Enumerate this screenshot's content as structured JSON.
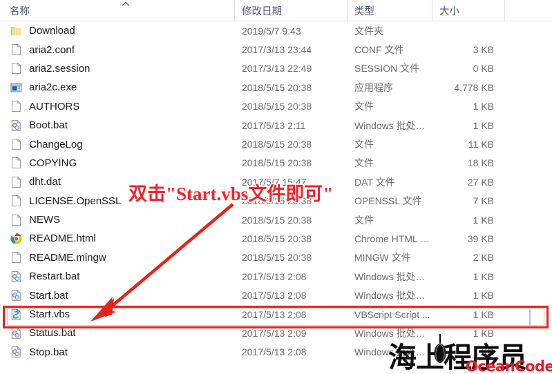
{
  "window": {
    "app": "windows-file-explorer-details-view"
  },
  "columns": {
    "name": "名称",
    "date_modified": "修改日期",
    "type": "类型",
    "size": "大小",
    "sort_indicator": "chevron-up-icon"
  },
  "files": [
    {
      "name": "Download",
      "icon": "folder-icon",
      "date": "2019/5/7 9:43",
      "type": "文件夹",
      "size": ""
    },
    {
      "name": "aria2.conf",
      "icon": "generic-file-icon",
      "date": "2017/3/13 23:44",
      "type": "CONF 文件",
      "size": "3 KB"
    },
    {
      "name": "aria2.session",
      "icon": "generic-file-icon",
      "date": "2017/3/13 22:49",
      "type": "SESSION 文件",
      "size": "0 KB"
    },
    {
      "name": "aria2c.exe",
      "icon": "executable-icon",
      "date": "2018/5/15 20:38",
      "type": "应用程序",
      "size": "4,778 KB"
    },
    {
      "name": "AUTHORS",
      "icon": "generic-file-icon",
      "date": "2018/5/15 20:38",
      "type": "文件",
      "size": "1 KB"
    },
    {
      "name": "Boot.bat",
      "icon": "batch-file-icon",
      "date": "2017/5/13 2:11",
      "type": "Windows 批处理...",
      "size": "1 KB"
    },
    {
      "name": "ChangeLog",
      "icon": "generic-file-icon",
      "date": "2018/5/15 20:38",
      "type": "文件",
      "size": "11 KB"
    },
    {
      "name": "COPYING",
      "icon": "generic-file-icon",
      "date": "2018/5/15 20:38",
      "type": "文件",
      "size": "18 KB"
    },
    {
      "name": "dht.dat",
      "icon": "generic-file-icon",
      "date": "2017/5/7 15:47",
      "type": "DAT 文件",
      "size": "27 KB"
    },
    {
      "name": "LICENSE.OpenSSL",
      "icon": "generic-file-icon",
      "date": "2018/5/15 20:38",
      "type": "OPENSSL 文件",
      "size": "7 KB"
    },
    {
      "name": "NEWS",
      "icon": "generic-file-icon",
      "date": "2018/5/15 20:38",
      "type": "文件",
      "size": "1 KB"
    },
    {
      "name": "README.html",
      "icon": "chrome-icon",
      "date": "2018/5/15 20:38",
      "type": "Chrome HTML D...",
      "size": "39 KB"
    },
    {
      "name": "README.mingw",
      "icon": "generic-file-icon",
      "date": "2018/5/15 20:38",
      "type": "MINGW 文件",
      "size": "2 KB"
    },
    {
      "name": "Restart.bat",
      "icon": "batch-file-icon",
      "date": "2017/5/13 2:08",
      "type": "Windows 批处理...",
      "size": "1 KB"
    },
    {
      "name": "Start.bat",
      "icon": "batch-file-icon",
      "date": "2017/5/13 2:08",
      "type": "Windows 批处理...",
      "size": "1 KB"
    },
    {
      "name": "Start.vbs",
      "icon": "vbscript-icon",
      "date": "2017/5/13 2:08",
      "type": "VBScript Script ...",
      "size": "1 KB"
    },
    {
      "name": "Status.bat",
      "icon": "batch-file-icon",
      "date": "2017/5/13 2:09",
      "type": "Windows 批处理...",
      "size": "1 KB"
    },
    {
      "name": "Stop.bat",
      "icon": "batch-file-icon",
      "date": "2017/5/13 2:08",
      "type": "Windows 批处理...",
      "size": "1 KB"
    }
  ],
  "annotation": {
    "text": "双击\"Start.vbs文件即可\"",
    "color": "#f3232a",
    "arrow": "red-arrow-pointing-to-start-vbs",
    "highlight_target": "Start.vbs",
    "highlight_color": "#e8211a"
  },
  "watermark": {
    "chinese": "海上程序员",
    "site": "OceanCoder.cn",
    "site_color": "#ee1c25"
  }
}
